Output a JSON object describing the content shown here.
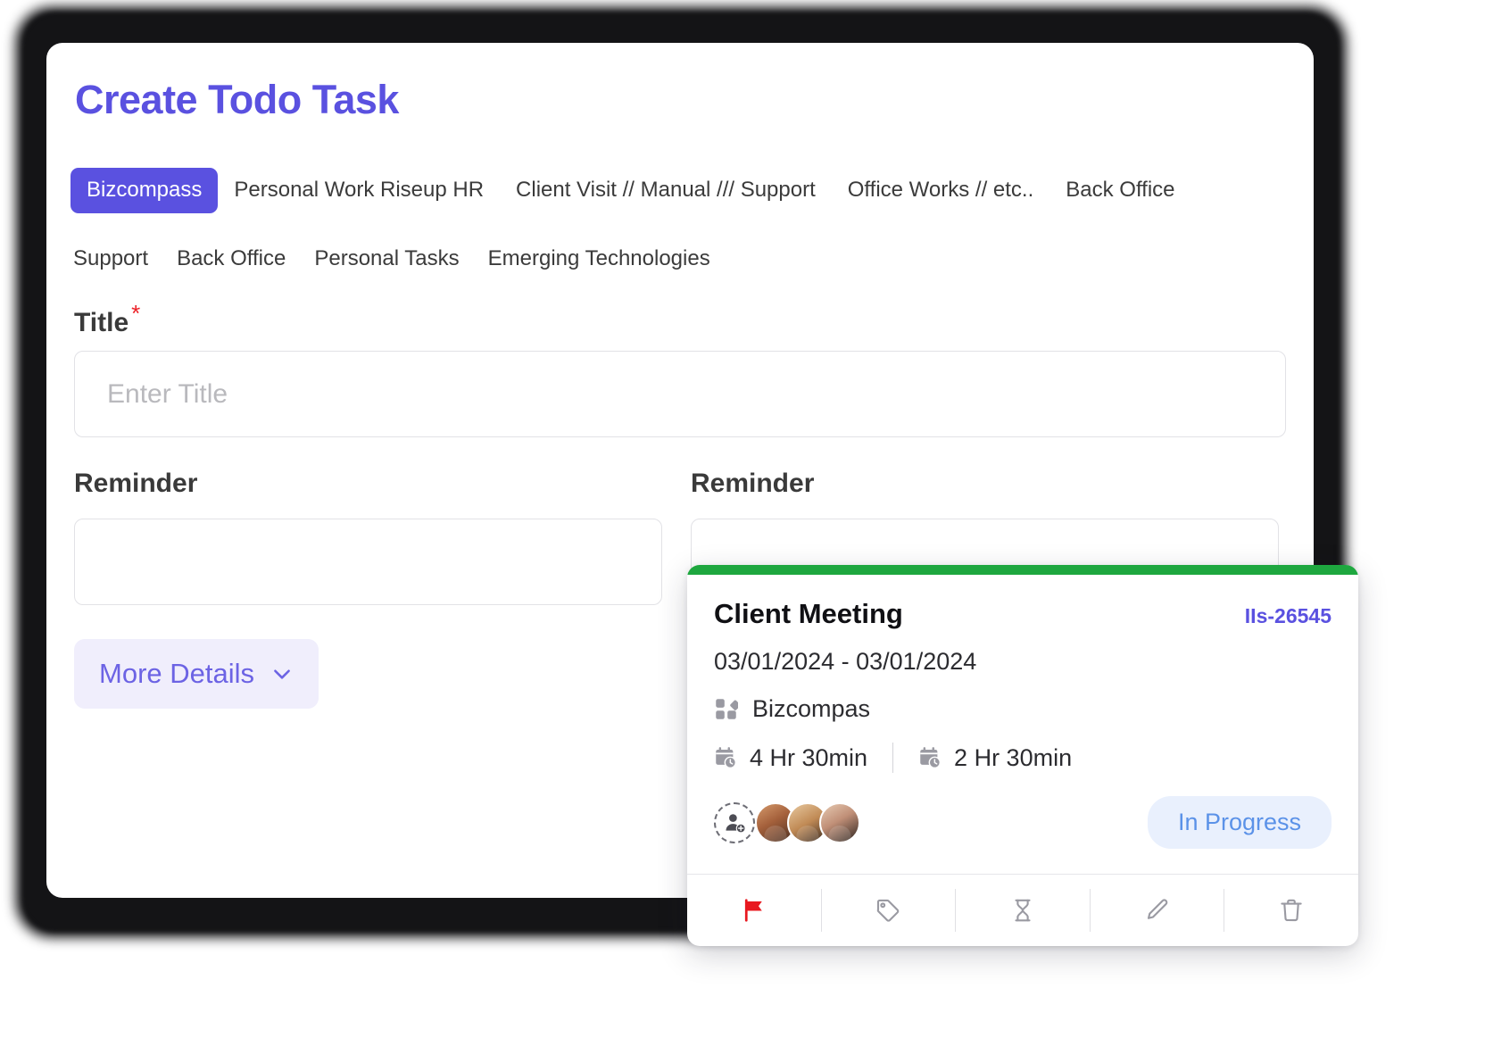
{
  "page": {
    "title": "Create Todo Task",
    "accent_color": "#5a51e0"
  },
  "tabs": {
    "row1": [
      {
        "label": "Bizcompass",
        "active": true
      },
      {
        "label": "Personal Work Riseup HR",
        "active": false
      },
      {
        "label": "Client Visit // Manual /// Support",
        "active": false
      },
      {
        "label": "Office Works // etc..",
        "active": false
      },
      {
        "label": "Back Office",
        "active": false
      }
    ],
    "row2": [
      {
        "label": "Support",
        "active": false
      },
      {
        "label": "Back Office",
        "active": false
      },
      {
        "label": "Personal Tasks",
        "active": false
      },
      {
        "label": "Emerging Technologies",
        "active": false
      }
    ]
  },
  "form": {
    "title_label": "Title",
    "required_marker": "*",
    "title_placeholder": "Enter Title",
    "title_value": "",
    "reminder_left_label": "Reminder",
    "reminder_left_value": "",
    "reminder_right_label": "Reminder",
    "reminder_right_value": "",
    "more_details_label": "More Details"
  },
  "task_card": {
    "status_color": "#1ea73f",
    "title": "Client Meeting",
    "id": "IIs-26545",
    "dates": "03/01/2024 - 03/01/2024",
    "project_icon": "grid-icon",
    "project": "Bizcompas",
    "estimated_icon": "calendar-clock-icon",
    "estimated_time": "4 Hr  30min",
    "spent_icon": "calendar-clock-icon",
    "spent_time": "2 Hr  30min",
    "add_person_icon": "add-person-icon",
    "assignee_count": 3,
    "status": "In Progress",
    "status_text_color": "#5b92e8",
    "status_bg_color": "#e9f0fd",
    "actions": [
      {
        "name": "flag-icon",
        "label": "Flag",
        "color": "#e8181f"
      },
      {
        "name": "tag-icon",
        "label": "Tag",
        "color": "#9a9aa2"
      },
      {
        "name": "hourglass-icon",
        "label": "Timer",
        "color": "#9a9aa2"
      },
      {
        "name": "pencil-icon",
        "label": "Edit",
        "color": "#9a9aa2"
      },
      {
        "name": "trash-icon",
        "label": "Delete",
        "color": "#9a9aa2"
      }
    ]
  }
}
